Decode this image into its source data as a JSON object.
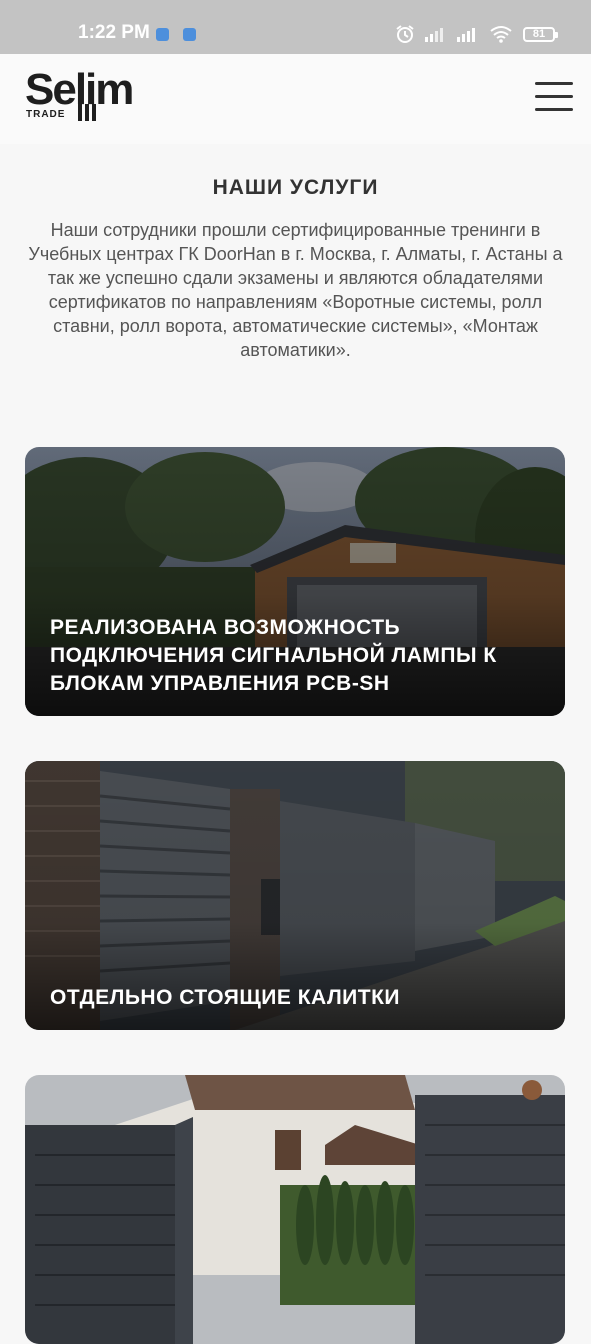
{
  "status_bar": {
    "time": "1:22 PM",
    "battery": "81",
    "icons": [
      "word-notification-icon",
      "word-notification-icon",
      "alarm-icon",
      "signal-icon",
      "signal-icon",
      "wifi-icon",
      "battery-icon"
    ]
  },
  "header": {
    "logo_name": "Selim",
    "logo_sub": "TRADE",
    "menu_icon": "hamburger-menu-icon"
  },
  "services": {
    "title": "НАШИ УСЛУГИ",
    "description": "Наши сотрудники прошли сертифицированные тренинги в Учебных центрах ГК DoorHan в г. Москва, г. Алматы, г. Астаны а так же успешно сдали экзамены и являются обладателями сертификатов по направлениям «Воротные системы, ролл ставни, ролл ворота, автоматические системы», «Монтаж автоматики».",
    "cards": [
      {
        "title": "РЕАЛИЗОВАНА ВОЗМОЖНОСТЬ ПОДКЛЮЧЕНИЯ СИГНАЛЬНОЙ ЛАМПЫ К БЛОКАМ УПРАВЛЕНИЯ PCB-SH",
        "image": "garage-photo"
      },
      {
        "title": "ОТДЕЛЬНО СТОЯЩИЕ КАЛИТКИ",
        "image": "fence-gate-photo"
      },
      {
        "title": "",
        "image": "swing-gates-photo"
      }
    ]
  }
}
